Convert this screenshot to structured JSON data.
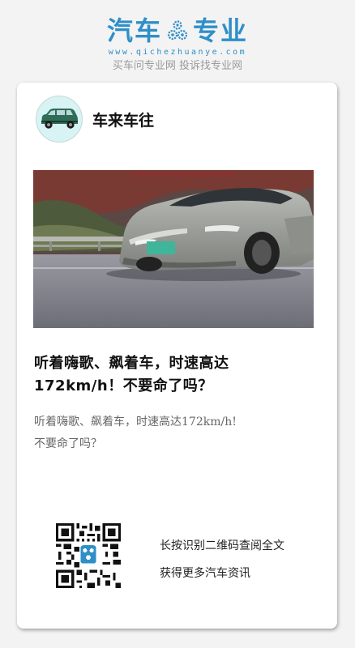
{
  "brand": {
    "name_part1": "汽车",
    "name_part2": "专业",
    "url": "www.qichezhuanye.com",
    "slogan": "买车问专业网 投诉找专业网",
    "color": "#2f8fc8"
  },
  "author": {
    "name": "车来车往",
    "avatar_icon": "green-suv-icon"
  },
  "article": {
    "image_icon": "grey-sedan-photo",
    "title": "听着嗨歌、飙着车，时速高达172km/h！不要命了吗？",
    "summary_line1": "听着嗨歌、飙着车，时速高达172km/h!",
    "summary_line2": "不要命了吗？"
  },
  "footer": {
    "qr_icon": "qr-code-icon",
    "line1": "长按识别二维码查阅全文",
    "line2": "获得更多汽车资讯"
  }
}
